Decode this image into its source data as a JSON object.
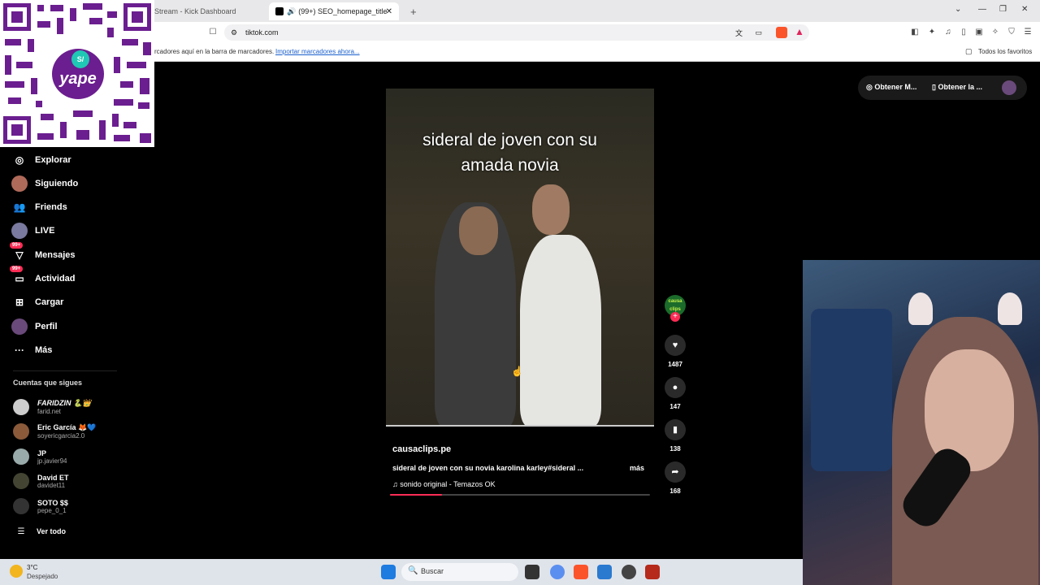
{
  "browser": {
    "tabs": [
      {
        "label": "Stream - Kick Dashboard"
      },
      {
        "label": "(99+) SEO_homepage_title"
      }
    ],
    "url": "tiktok.com",
    "bookmarks_hint": "rcadores aquí en la barra de marcadores.",
    "import_link": "Importar marcadores ahora...",
    "all_favorites": "Todos los favoritos"
  },
  "qr": {
    "brand": "yape",
    "badge": "S/"
  },
  "sidebar": {
    "items": [
      {
        "label": "Explorar",
        "icon": "compass-icon"
      },
      {
        "label": "Siguiendo",
        "icon": "avatar-icon"
      },
      {
        "label": "Friends",
        "icon": "people-icon"
      },
      {
        "label": "LIVE",
        "icon": "live-icon"
      },
      {
        "label": "Mensajes",
        "icon": "message-icon",
        "badge": "99+"
      },
      {
        "label": "Actividad",
        "icon": "inbox-icon",
        "badge": "99+"
      },
      {
        "label": "Cargar",
        "icon": "plus-square-icon"
      },
      {
        "label": "Perfil",
        "icon": "profile-icon"
      },
      {
        "label": "Más",
        "icon": "more-icon"
      }
    ],
    "following_title": "Cuentas que sigues",
    "accounts": [
      {
        "name": "FARIDZIN 🐍👑",
        "handle": "farid.net"
      },
      {
        "name": "Eric García 🦊💙",
        "handle": "soyericgarcia2.0"
      },
      {
        "name": "JP",
        "handle": "jp.javier94"
      },
      {
        "name": "David ET",
        "handle": "davidet11"
      },
      {
        "name": "SOTO $$",
        "handle": "pepe_0_1"
      }
    ],
    "see_all": "Ver todo"
  },
  "topright": {
    "btn1": "Obtener M...",
    "btn2": "Obtener la ..."
  },
  "video": {
    "overlay_line1": "sideral  de joven con su",
    "overlay_line2": "amada novia",
    "author": "causaclips.pe",
    "caption": "sideral de joven con su novia karolina karley#sideral ...",
    "more": "más",
    "sound": "sonido original - Temazos OK",
    "avatar_text": "causa clips",
    "likes": "1487",
    "comments": "147",
    "saves": "138",
    "shares": "168",
    "progress": 0.2
  },
  "taskbar": {
    "temp": "3°C",
    "weather": "Despejado",
    "search": "Buscar"
  },
  "colors": {
    "accent": "#fe2c55"
  }
}
